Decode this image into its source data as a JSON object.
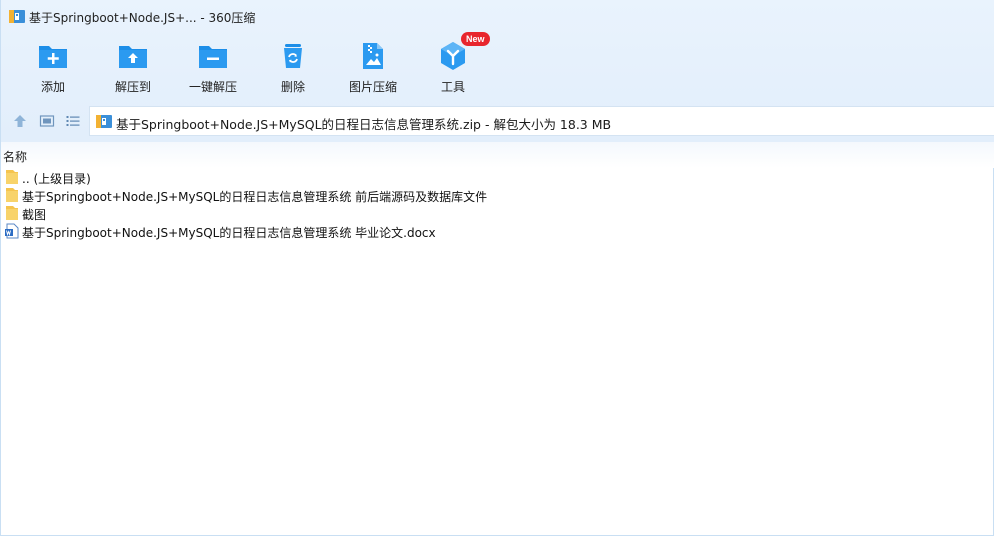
{
  "window": {
    "title": "基于Springboot+Node.JS+... - 360压缩"
  },
  "toolbar": {
    "items": [
      {
        "label": "添加",
        "icon": "add-icon"
      },
      {
        "label": "解压到",
        "icon": "extract-to-icon"
      },
      {
        "label": "一键解压",
        "icon": "one-click-extract-icon"
      },
      {
        "label": "删除",
        "icon": "delete-icon"
      },
      {
        "label": "图片压缩",
        "icon": "image-compress-icon"
      },
      {
        "label": "工具",
        "icon": "tools-icon",
        "badge": "New"
      }
    ]
  },
  "address": {
    "path": "基于Springboot+Node.JS+MySQL的日程日志信息管理系统.zip - 解包大小为 18.3 MB"
  },
  "list": {
    "column_name": "名称",
    "rows": [
      {
        "name": ".. (上级目录)",
        "type": "folder"
      },
      {
        "name": "基于Springboot+Node.JS+MySQL的日程日志信息管理系统 前后端源码及数据库文件",
        "type": "folder"
      },
      {
        "name": "截图",
        "type": "folder"
      },
      {
        "name": "基于Springboot+Node.JS+MySQL的日程日志信息管理系统 毕业论文.docx",
        "type": "docx"
      }
    ]
  },
  "colors": {
    "accent": "#1c8ee8",
    "toolbar_bg": "#e6f1fc",
    "badge": "#e8262d",
    "folder": "#f5c44e"
  }
}
